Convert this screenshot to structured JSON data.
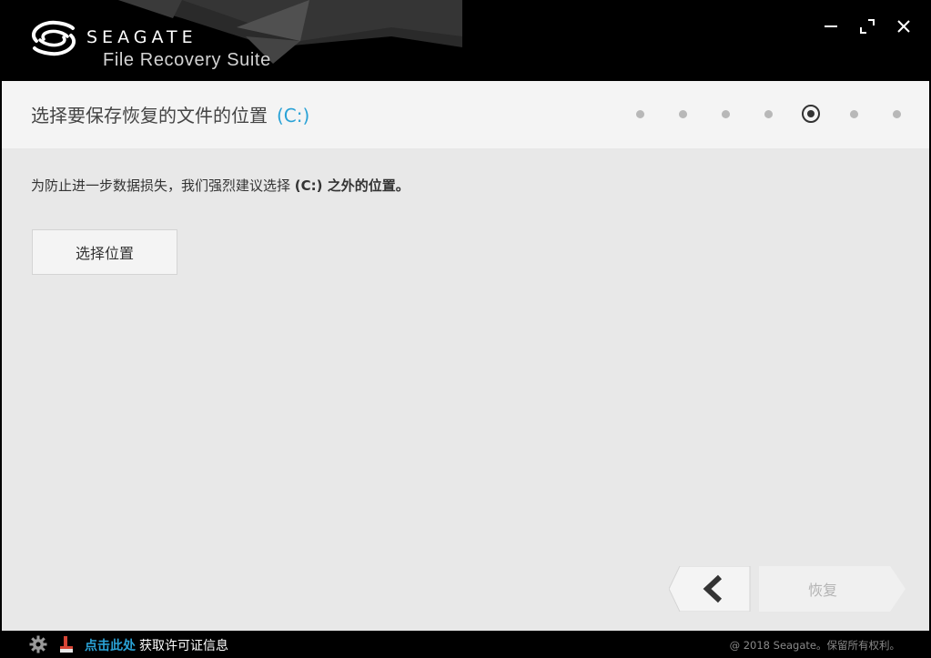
{
  "app": {
    "brand": "SEAGATE",
    "product": "File Recovery Suite"
  },
  "window_controls": {
    "minimize": "minimize-icon",
    "maximize": "maximize-icon",
    "close": "close-icon"
  },
  "header": {
    "title": "选择要保存恢复的文件的位置",
    "drive": "(C:)"
  },
  "steps": {
    "total": 7,
    "current": 5
  },
  "main": {
    "warning_prefix": "为防止进一步数据损失，我们强烈建议选择 ",
    "warning_drive": "(C:)",
    "warning_suffix": " 之外的位置。",
    "choose_location_label": "选择位置",
    "back_icon": "chevron-left-icon",
    "recover_label": "恢复"
  },
  "footer": {
    "settings_icon": "gear-icon",
    "language_icon": "flag-icon",
    "link_text": "点击此处",
    "license_text": "获取许可证信息",
    "copyright": "@ 2018 Seagate。保留所有权利。"
  },
  "colors": {
    "accent": "#2aa2d6",
    "header_bg": "#000000",
    "content_bg": "#e8e8e8",
    "titlebar_bg": "#f4f4f4"
  }
}
